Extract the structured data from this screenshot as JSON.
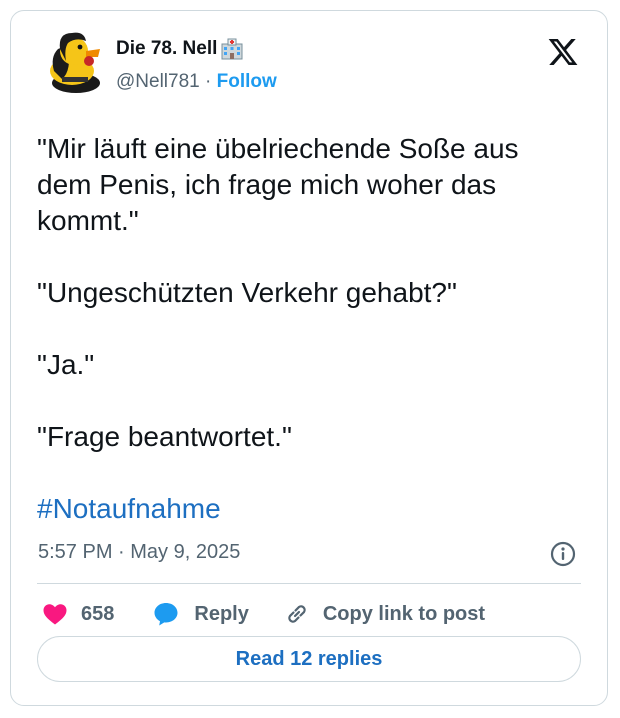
{
  "author": {
    "display_name": "Die 78. Nell",
    "handle": "@Nell781",
    "separator": "·",
    "follow_label": "Follow"
  },
  "tweet": {
    "text": "\"Mir läuft eine übelriechende Soße aus\ndem Penis, ich frage mich woher das\nkommt.\"\n\n\"Ungeschützten Verkehr gehabt?\"\n\n\"Ja.\"\n\n\"Frage beantwortet.\"",
    "hashtag": "#Notaufnahme",
    "timestamp": "5:57 PM · May 9, 2025"
  },
  "actions": {
    "like_count": "658",
    "reply_label": "Reply",
    "copy_link_label": "Copy link to post"
  },
  "footer": {
    "read_replies_label": "Read 12 replies"
  },
  "colors": {
    "accent": "#1d9bf0",
    "link": "#1d6fc1",
    "heart": "#f91880",
    "secondary_text": "#536471",
    "border": "#cfd9de"
  },
  "icons": [
    "avatar-rubber-duck",
    "hospital-emoji-icon",
    "x-logo-icon",
    "info-icon",
    "heart-icon",
    "reply-bubble-icon",
    "link-icon"
  ]
}
